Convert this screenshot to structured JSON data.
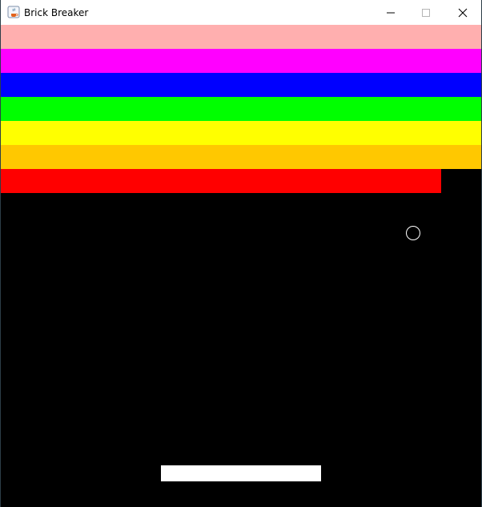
{
  "window": {
    "title": "Brick Breaker",
    "icon": "java-cup-icon",
    "controls": {
      "minimize_icon": "minimize-icon",
      "maximize_icon": "maximize-icon",
      "close_icon": "close-icon"
    }
  },
  "game": {
    "background_color": "#000000",
    "brick_rows": [
      {
        "color": "#ffafaf",
        "bricks_remaining_fraction": 1.0
      },
      {
        "color": "#ff00ff",
        "bricks_remaining_fraction": 1.0
      },
      {
        "color": "#0000ff",
        "bricks_remaining_fraction": 1.0
      },
      {
        "color": "#00ff00",
        "bricks_remaining_fraction": 1.0
      },
      {
        "color": "#ffff00",
        "bricks_remaining_fraction": 1.0
      },
      {
        "color": "#ffc800",
        "bricks_remaining_fraction": 1.0
      },
      {
        "color": "#ff0000",
        "bricks_remaining_fraction": 0.9167
      }
    ],
    "ball": {
      "color": "#ffffff",
      "style": "outline"
    },
    "paddle": {
      "color": "#ffffff"
    }
  }
}
